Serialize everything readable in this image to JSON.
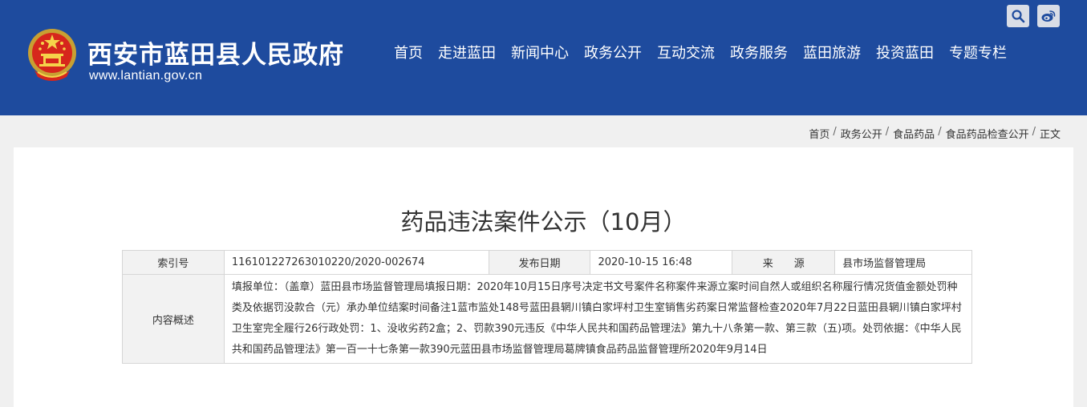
{
  "header": {
    "site_title": "西安市蓝田县人民政府",
    "site_url": "www.lantian.gov.cn",
    "bg_color": "#1e4b9e",
    "nav": [
      "首页",
      "走进蓝田",
      "新闻中心",
      "政务公开",
      "互动交流",
      "政务服务",
      "蓝田旅游",
      "投资蓝田",
      "专题专栏"
    ],
    "icons": {
      "search": "search-icon",
      "weibo": "weibo-icon"
    }
  },
  "breadcrumb": [
    "首页",
    "政务公开",
    "食品药品",
    "食品药品检查公开",
    "正文"
  ],
  "article": {
    "title": "药品违法案件公示（10月）"
  },
  "info": {
    "index_label": "索引号",
    "index_value": "116101227263010220/2020-002674",
    "date_label": "发布日期",
    "date_value": "2020-10-15 16:48",
    "source_label": "来　　源",
    "source_value": "县市场监督管理局",
    "summary_label": "内容概述",
    "summary_value": "填报单位：（盖章）蓝田县市场监督管理局填报日期：2020年10月15日序号决定书文号案件名称案件来源立案时间自然人或组织名称履行情况货值金额处罚种类及依据罚没款合（元）承办单位结案时间备注1蓝市监处148号蓝田县辋川镇白家坪村卫生室销售劣药案日常监督检查2020年7月22日蓝田县辋川镇白家坪村卫生室完全履行26行政处罚：1、没收劣药2盒；2、罚款390元违反《中华人民共和国药品管理法》第九十八条第一款、第三款（五)项。处罚依据：《中华人民共和国药品管理法》第一百一十七条第一款390元蓝田县市场监督管理局葛牌镇食品药品监督管理所2020年9月14日"
  }
}
